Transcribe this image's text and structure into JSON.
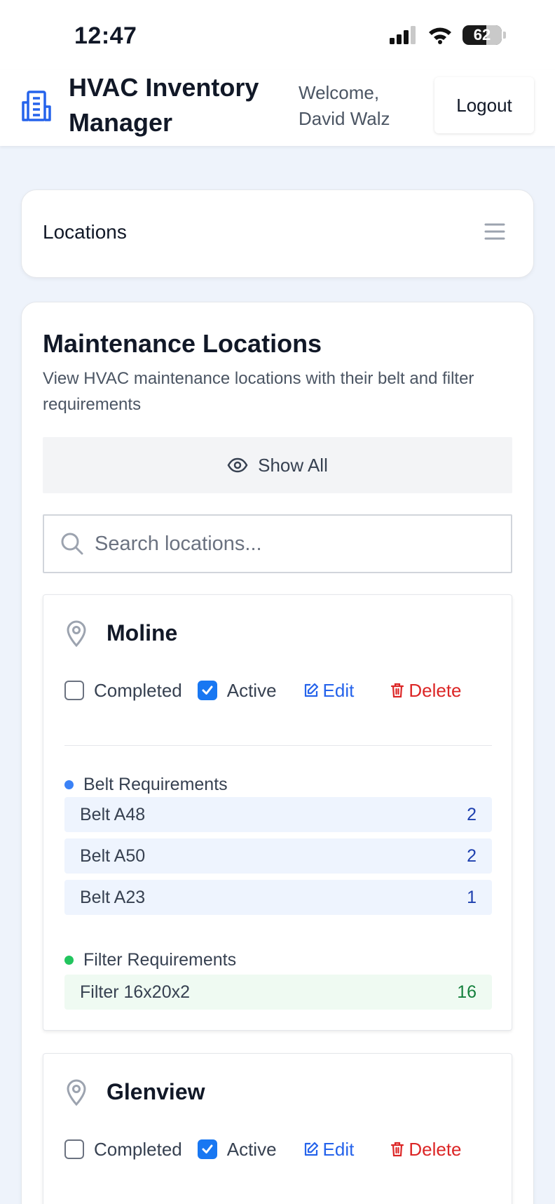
{
  "status_bar": {
    "time": "12:47",
    "battery": "62"
  },
  "header": {
    "title": "HVAC Inventory Manager",
    "welcome": "Welcome, David Walz",
    "logout_label": "Logout"
  },
  "nav": {
    "title": "Locations"
  },
  "main": {
    "title": "Maintenance Locations",
    "description": "View HVAC maintenance locations with their belt and filter requirements",
    "show_all_label": "Show All",
    "search_placeholder": "Search locations..."
  },
  "labels": {
    "completed": "Completed",
    "active": "Active",
    "edit": "Edit",
    "delete": "Delete",
    "belt_requirements": "Belt Requirements",
    "filter_requirements": "Filter Requirements"
  },
  "locations": [
    {
      "name": "Moline",
      "completed": false,
      "active": true,
      "belts": [
        {
          "name": "Belt A48",
          "qty": "2"
        },
        {
          "name": "Belt A50",
          "qty": "2"
        },
        {
          "name": "Belt A23",
          "qty": "1"
        }
      ],
      "filters": [
        {
          "name": "Filter 16x20x2",
          "qty": "16"
        }
      ]
    },
    {
      "name": "Glenview",
      "completed": false,
      "active": true
    }
  ],
  "colors": {
    "accent_blue": "#2563eb",
    "checkbox_blue": "#1877f2",
    "delete_red": "#dc2626",
    "belt_dot": "#3b82f6",
    "filter_dot": "#22c55e",
    "page_bg": "#eef3fb"
  }
}
